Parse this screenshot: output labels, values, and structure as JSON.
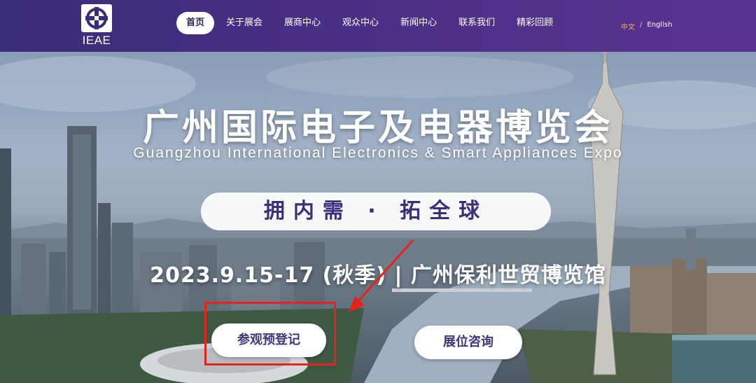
{
  "nav": {
    "logo_text": "IEAE",
    "items": [
      {
        "label": "首页",
        "active": true
      },
      {
        "label": "关于展会",
        "active": false
      },
      {
        "label": "展商中心",
        "active": false
      },
      {
        "label": "观众中心",
        "active": false
      },
      {
        "label": "新闻中心",
        "active": false
      },
      {
        "label": "联系我们",
        "active": false
      },
      {
        "label": "精彩回顾",
        "active": false
      }
    ],
    "lang": {
      "current": "中文",
      "separator": "/",
      "other": "English"
    }
  },
  "hero": {
    "title_cn": "广州国际电子及电器博览会",
    "title_en": "Guangzhou International Electronics & Smart Appliances Expo",
    "slogan": "拥内需 · 拓全球",
    "date_venue": "2023.9.15-17 (秋季) | 广州保利世贸博览馆"
  },
  "buttons": {
    "register": "参观预登记",
    "booth": "展位咨询"
  },
  "colors": {
    "nav_bg": "#4a2f86",
    "brand_text": "#3a2f7a",
    "annotation_red": "#e5231b",
    "lang_active": "#f0b43c"
  }
}
